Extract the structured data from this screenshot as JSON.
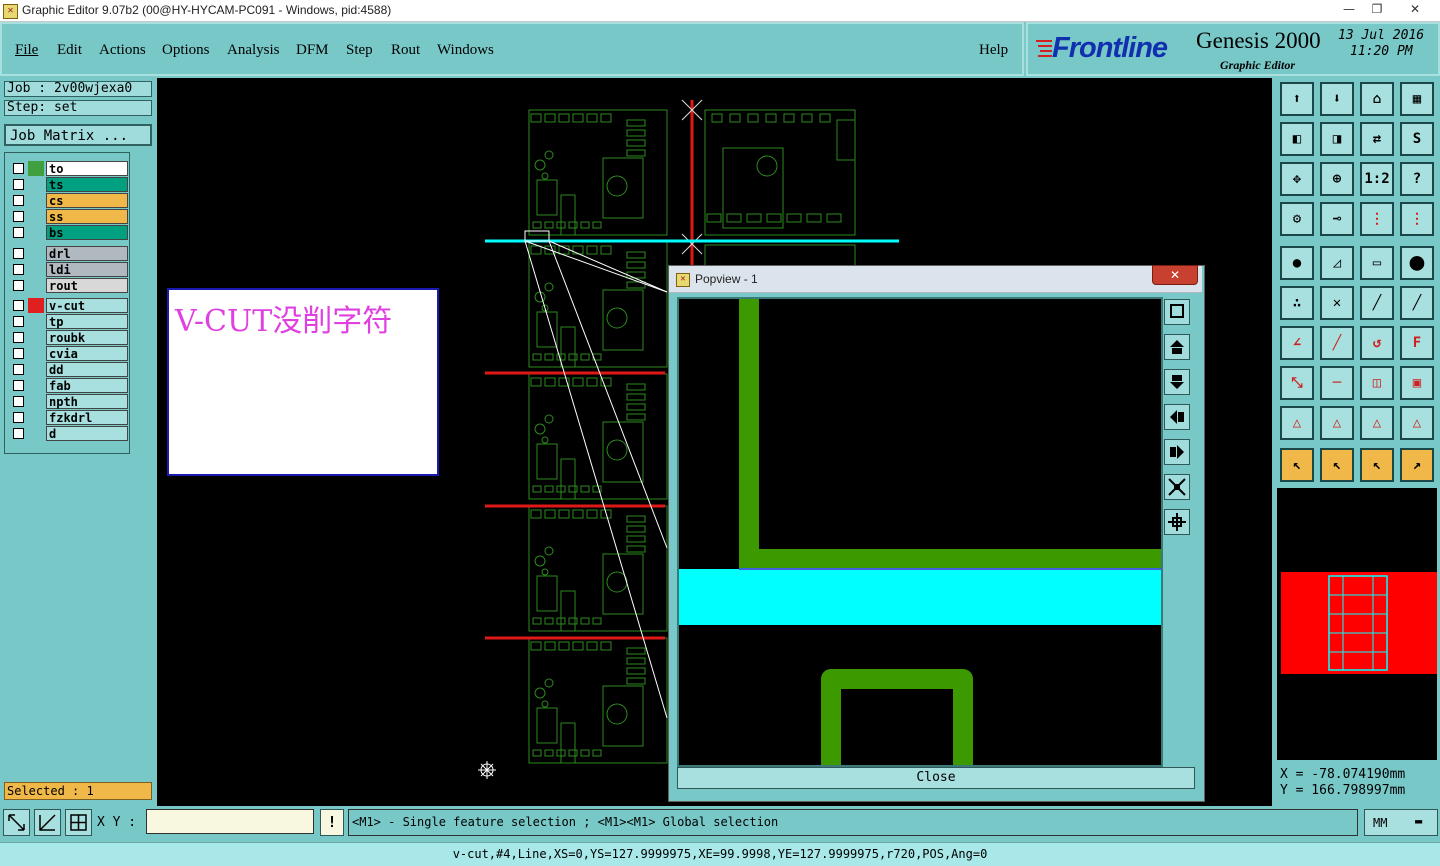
{
  "window": {
    "title": "Graphic Editor 9.07b2 (00@HY-HYCAM-PC091 - Windows, pid:4588)",
    "minimize": "—",
    "restore": "❐",
    "close": "✕"
  },
  "menu": {
    "items": [
      "File",
      "Edit",
      "Actions",
      "Options",
      "Analysis",
      "DFM",
      "Step",
      "Rout",
      "Windows"
    ],
    "help": "Help"
  },
  "brand": {
    "logo": "Frontline",
    "product": "Genesis 2000",
    "subtitle": "Graphic Editor",
    "date": "13 Jul 2016",
    "time": "11:20 PM"
  },
  "job": {
    "job_label": "Job : 2v00wjexa0",
    "step_label": "Step: set",
    "matrix_button": "Job Matrix ..."
  },
  "layers": [
    {
      "name": "to",
      "color": "#ffffff",
      "swatch": "#40a040"
    },
    {
      "name": "ts",
      "color": "#00a080",
      "swatch": "#78c8c8"
    },
    {
      "name": "cs",
      "color": "#f0b848",
      "swatch": "#78c8c8"
    },
    {
      "name": "ss",
      "color": "#f0b848",
      "swatch": "#78c8c8"
    },
    {
      "name": "bs",
      "color": "#00a080",
      "swatch": "#78c8c8"
    },
    {
      "name": "drl",
      "color": "#b0b8c0",
      "swatch": "#78c8c8"
    },
    {
      "name": "ldi",
      "color": "#b0b8c0",
      "swatch": "#78c8c8"
    },
    {
      "name": "rout",
      "color": "#d8d8d8",
      "swatch": "#78c8c8"
    },
    {
      "name": "v-cut",
      "color": "#a8e0e0",
      "swatch": "#e02020"
    },
    {
      "name": "tp",
      "color": "#a8e0e0",
      "swatch": "#78c8c8"
    },
    {
      "name": "roubk",
      "color": "#a8e0e0",
      "swatch": "#78c8c8"
    },
    {
      "name": "cvia",
      "color": "#a8e0e0",
      "swatch": "#78c8c8"
    },
    {
      "name": "dd",
      "color": "#a8e0e0",
      "swatch": "#78c8c8"
    },
    {
      "name": "fab",
      "color": "#a8e0e0",
      "swatch": "#78c8c8"
    },
    {
      "name": "npth",
      "color": "#a8e0e0",
      "swatch": "#78c8c8"
    },
    {
      "name": "fzkdrl",
      "color": "#a8e0e0",
      "swatch": "#78c8c8"
    },
    {
      "name": "d",
      "color": "#a8e0e0",
      "swatch": "#78c8c8"
    }
  ],
  "selected": "Selected : 1",
  "note": "V-CUT没削字符",
  "popview": {
    "title": "Popview - 1",
    "close_label": "Close"
  },
  "coords": {
    "x": "X  =  -78.074190mm",
    "y": "Y  =  166.798997mm"
  },
  "bottom": {
    "xy_label": "X Y :",
    "xy_value": "",
    "hint": "<M1> - Single feature selection ; <M1><M1> Global selection",
    "units": "MM",
    "status": "v-cut,#4,Line,XS=0,YS=127.9999975,XE=99.9998,YE=127.9999975,r720,POS,Ang=0"
  },
  "colors": {
    "vcut_line": "#e01818",
    "selected_line": "#00ffff",
    "pcb_outline": "#3c9a00",
    "background": "#78c8c8"
  }
}
